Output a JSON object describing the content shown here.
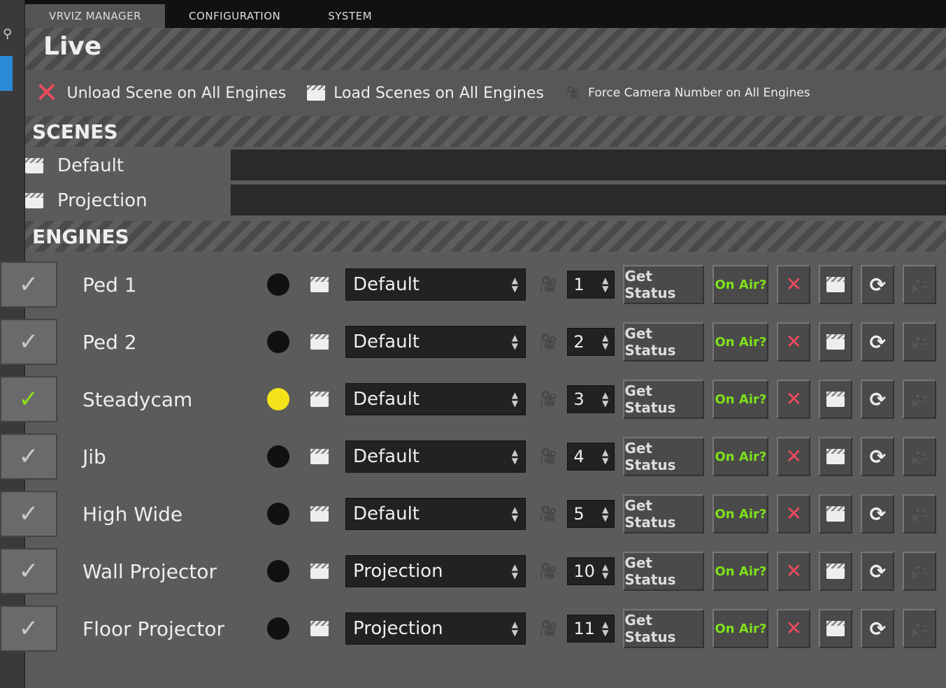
{
  "tabs": [
    "VRVIZ MANAGER",
    "CONFIGURATION",
    "SYSTEM"
  ],
  "page_title": "Live",
  "actions": {
    "unload": "Unload Scene on All Engines",
    "load": "Load Scenes on All Engines",
    "force_camera": "Force Camera Number on All Engines"
  },
  "scenes": {
    "title": "SCENES",
    "items": [
      "Default",
      "Projection"
    ]
  },
  "engines": {
    "title": "ENGINES",
    "get_status": "Get Status",
    "on_air": "On Air?",
    "rows": [
      {
        "name": "Ped 1",
        "checked": false,
        "status": "black",
        "scene": "Default",
        "camera": "1"
      },
      {
        "name": "Ped 2",
        "checked": false,
        "status": "black",
        "scene": "Default",
        "camera": "2"
      },
      {
        "name": "Steadycam",
        "checked": true,
        "status": "yellow",
        "scene": "Default",
        "camera": "3"
      },
      {
        "name": "Jib",
        "checked": false,
        "status": "black",
        "scene": "Default",
        "camera": "4"
      },
      {
        "name": "High Wide",
        "checked": false,
        "status": "black",
        "scene": "Default",
        "camera": "5"
      },
      {
        "name": "Wall Projector",
        "checked": false,
        "status": "black",
        "scene": "Projection",
        "camera": "10"
      },
      {
        "name": "Floor Projector",
        "checked": false,
        "status": "black",
        "scene": "Projection",
        "camera": "11"
      }
    ]
  },
  "colors": {
    "accent_green": "#7ee21a",
    "danger_red": "#f04a5c",
    "status_yellow": "#f4e21a"
  }
}
